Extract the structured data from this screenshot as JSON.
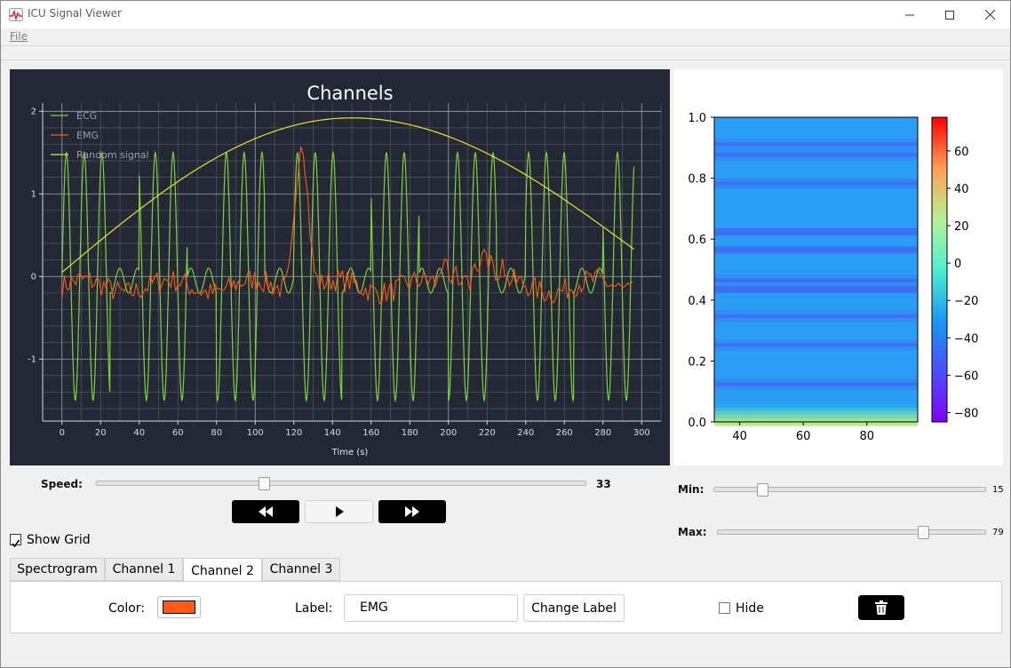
{
  "window": {
    "title": "ICU Signal Viewer",
    "app_icon": "heartbeat-icon"
  },
  "menu": {
    "file": "File"
  },
  "colors": {
    "plot_bg": "#232834",
    "ecg": "#7cd23a",
    "emg": "#ff5a14",
    "random": "#e6e629",
    "color_swatch": "#ff5a14"
  },
  "chart_data": [
    {
      "type": "line",
      "title": "Channels",
      "xlabel": "Time (s)",
      "ylabel": "",
      "xlim": [
        -10,
        310
      ],
      "ylim": [
        -1.75,
        2.1
      ],
      "x_ticks": [
        0,
        20,
        40,
        60,
        80,
        100,
        120,
        140,
        160,
        180,
        200,
        220,
        240,
        260,
        280,
        300
      ],
      "y_ticks": [
        -1,
        0,
        1,
        2
      ],
      "grid": true,
      "legend_position": "top-left",
      "series": [
        {
          "name": "ECG",
          "description": "oscillating sinusoid bursts between -1.5 and 1.5",
          "x_range": [
            0,
            296
          ]
        },
        {
          "name": "EMG",
          "description": "noisy trace around -0.1 with a spike to 1.8 near x=124",
          "x_range": [
            0,
            296
          ]
        },
        {
          "name": "Random signal",
          "description": "arc from 0.05 at x=0 to peak 1.92 at x=150 to 0.33 at x=296",
          "x_range": [
            0,
            296
          ]
        }
      ]
    },
    {
      "type": "heatmap",
      "title": "",
      "xlim": [
        32,
        96
      ],
      "ylim": [
        0.0,
        1.0
      ],
      "x_ticks": [
        40,
        60,
        80
      ],
      "y_ticks": [
        "0.0",
        "0.2",
        "0.4",
        "0.6",
        "0.8",
        "1.0"
      ],
      "colorbar_ticks": [
        60,
        40,
        20,
        0,
        -20,
        -40,
        -60,
        -80
      ],
      "colorbar_range": [
        -85,
        78
      ],
      "colormap": "rainbow"
    }
  ],
  "controls": {
    "speed_label": "Speed:",
    "speed_value": "33",
    "speed_fraction": 0.34,
    "rewind_icon": "rewind-icon",
    "play_icon": "play-icon",
    "forward_icon": "fast-forward-icon",
    "show_grid_label": "Show Grid",
    "show_grid_checked": true,
    "min_label": "Min:",
    "min_value": "15",
    "min_fraction": 0.167,
    "max_label": "Max:",
    "max_value": "79",
    "max_fraction": 0.78
  },
  "tabs": [
    {
      "label": "Spectrogram",
      "active": false
    },
    {
      "label": "Channel 1",
      "active": false
    },
    {
      "label": "Channel 2",
      "active": true
    },
    {
      "label": "Channel 3",
      "active": false
    }
  ],
  "channel_panel": {
    "color_label": "Color:",
    "label_label": "Label:",
    "label_value": "EMG",
    "change_label_button": "Change Label",
    "hide_label": "Hide",
    "hide_checked": false,
    "delete_icon": "trash-icon"
  }
}
